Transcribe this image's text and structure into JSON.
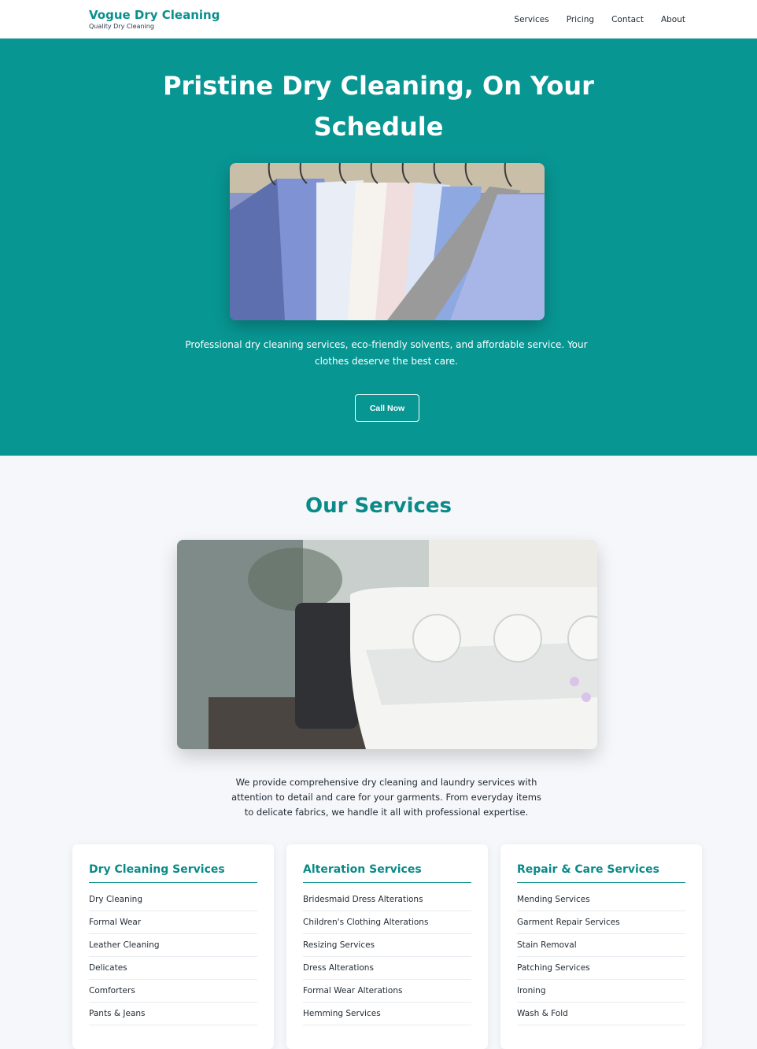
{
  "header": {
    "brand_name": "Vogue Dry Cleaning",
    "brand_tagline": "Quality Dry Cleaning",
    "nav": [
      "Services",
      "Pricing",
      "Contact",
      "About"
    ]
  },
  "hero": {
    "title": "Pristine Dry Cleaning, On Your Schedule",
    "image_icon": "shirts-on-hangers-photo",
    "text": "Professional dry cleaning services, eco-friendly solvents, and affordable service. Your clothes deserve the best care.",
    "button_label": "Call Now"
  },
  "services": {
    "title": "Our Services",
    "image_icon": "sewing-machine-photo",
    "text": "We provide comprehensive dry cleaning and laundry services with attention to detail and care for your garments. From everyday items to delicate fabrics, we handle it all with professional expertise.",
    "cards": [
      {
        "title": "Dry Cleaning Services",
        "items": [
          "Dry Cleaning",
          "Formal Wear",
          "Leather Cleaning",
          "Delicates",
          "Comforters",
          "Pants & Jeans"
        ]
      },
      {
        "title": "Alteration Services",
        "items": [
          "Bridesmaid Dress Alterations",
          "Children's Clothing Alterations",
          "Resizing Services",
          "Dress Alterations",
          "Formal Wear Alterations",
          "Hemming Services"
        ]
      },
      {
        "title": "Repair & Care Services",
        "items": [
          "Mending Services",
          "Garment Repair Services",
          "Stain Removal",
          "Patching Services",
          "Ironing",
          "Wash & Fold"
        ]
      }
    ]
  },
  "colors": {
    "brand": "#0a8f8c",
    "hero_bg": "#089693",
    "page_bg": "#f5f7fa"
  }
}
